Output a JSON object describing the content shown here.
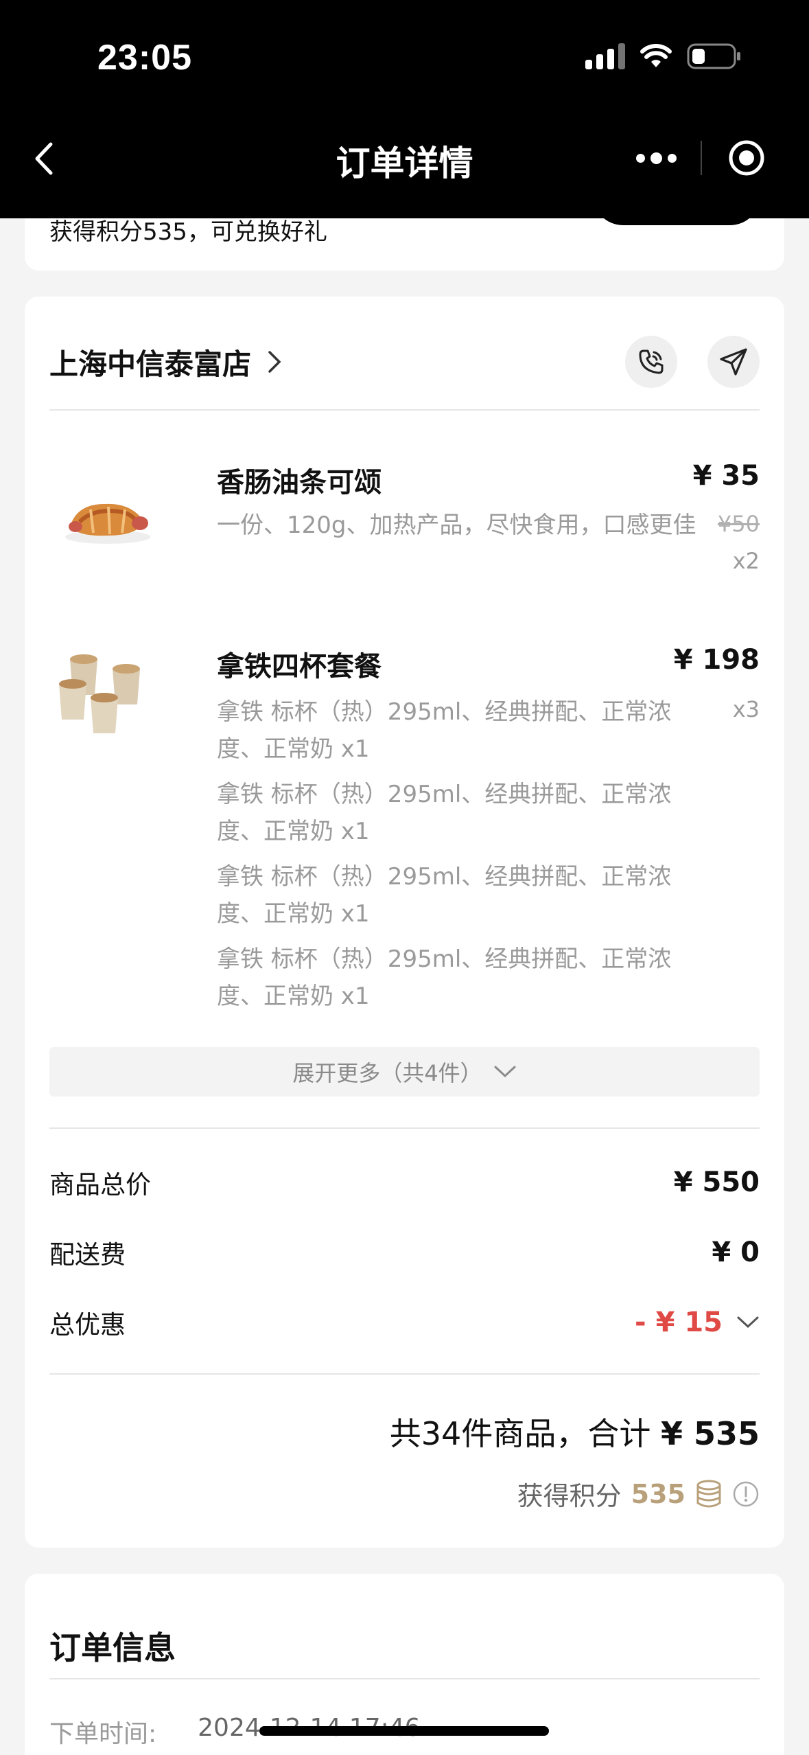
{
  "status_bar": {
    "time": "23:05"
  },
  "nav": {
    "title": "订单详情"
  },
  "rewards": {
    "points_text": "获得积分535，可兑换好礼"
  },
  "store": {
    "name": "上海中信泰富店"
  },
  "items": [
    {
      "name": "香肠油条可颂",
      "desc": "一份、120g、加热产品，尽快食用，口感更佳",
      "price": "¥ 35",
      "orig_price": "¥50",
      "qty": "x2"
    },
    {
      "name": "拿铁四杯套餐",
      "desc_lines": [
        "拿铁 标杯（热）295ml、经典拼配、正常浓度、正常奶 x1",
        "拿铁 标杯（热）295ml、经典拼配、正常浓度、正常奶 x1",
        "拿铁 标杯（热）295ml、经典拼配、正常浓度、正常奶 x1",
        "拿铁 标杯（热）295ml、经典拼配、正常浓度、正常奶 x1"
      ],
      "price": "¥ 198",
      "qty": "x3"
    }
  ],
  "expand": {
    "label": "展开更多（共4件）"
  },
  "summary": {
    "goods_label": "商品总价",
    "goods_value": "¥ 550",
    "delivery_label": "配送费",
    "delivery_value": "¥ 0",
    "discount_label": "总优惠",
    "discount_value": "- ¥ 15"
  },
  "total": {
    "prefix": "共34件商品，合计",
    "amount": "¥ 535"
  },
  "earn": {
    "label": "获得积分",
    "points": "535"
  },
  "order_info": {
    "title": "订单信息",
    "time_label": "下单时间:",
    "time_value": "2024-12-14 17:46"
  },
  "colors": {
    "accent_red": "#e04a45",
    "points_gold": "#b8a07a"
  },
  "icons": [
    "back-icon",
    "more-icon",
    "target-icon",
    "chevron-right-icon",
    "phone-icon",
    "navigate-icon",
    "chevron-down-icon",
    "coins-icon",
    "info-icon"
  ]
}
